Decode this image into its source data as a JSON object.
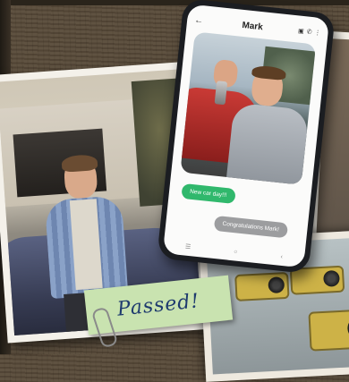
{
  "phone": {
    "contact_name": "Mark",
    "icons": {
      "back": "back-arrow-icon",
      "video": "video-camera-icon",
      "call": "phone-icon",
      "more": "more-vertical-icon"
    },
    "messages": [
      {
        "direction": "sent",
        "text": "New car day!!!"
      },
      {
        "direction": "received",
        "text": "Congratulations Mark!"
      }
    ],
    "sent_bubble_color": "#30b86c",
    "received_bubble_color": "#9c9d9f"
  },
  "sticky_note": {
    "text": "Passed!",
    "color": "#c9e3b0",
    "ink_color": "#1e3a6e"
  }
}
